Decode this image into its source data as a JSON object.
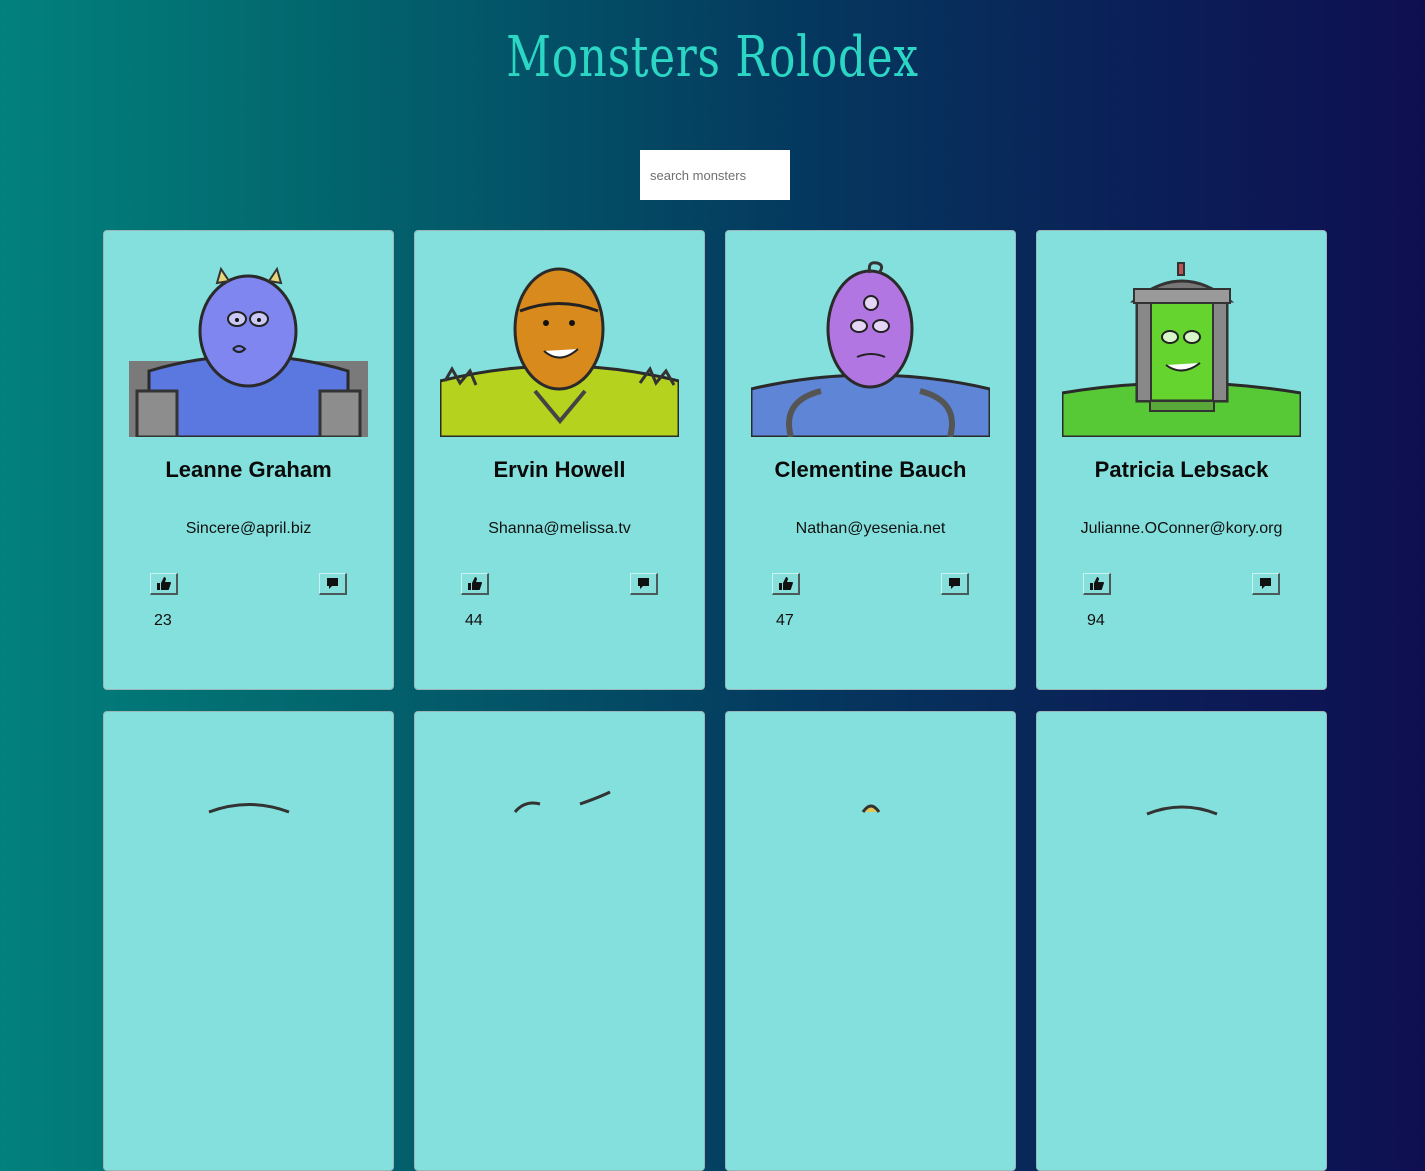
{
  "app": {
    "title": "Monsters Rolodex"
  },
  "search": {
    "placeholder": "search monsters",
    "value": ""
  },
  "monsters": [
    {
      "name": "Leanne Graham",
      "email": "Sincere@april.biz",
      "likes": "23",
      "skin": "#7f86f0",
      "body": "#5a78e0"
    },
    {
      "name": "Ervin Howell",
      "email": "Shanna@melissa.tv",
      "likes": "44",
      "skin": "#d88a1c",
      "body": "#b5d21e"
    },
    {
      "name": "Clementine Bauch",
      "email": "Nathan@yesenia.net",
      "likes": "47",
      "skin": "#b276e3",
      "body": "#5f86d6"
    },
    {
      "name": "Patricia Lebsack",
      "email": "Julianne.OConner@kory.org",
      "likes": "94",
      "skin": "#66d42e",
      "body": "#57c936"
    }
  ],
  "icons": {
    "like": "thumbs-up-icon",
    "comment": "comment-icon"
  }
}
